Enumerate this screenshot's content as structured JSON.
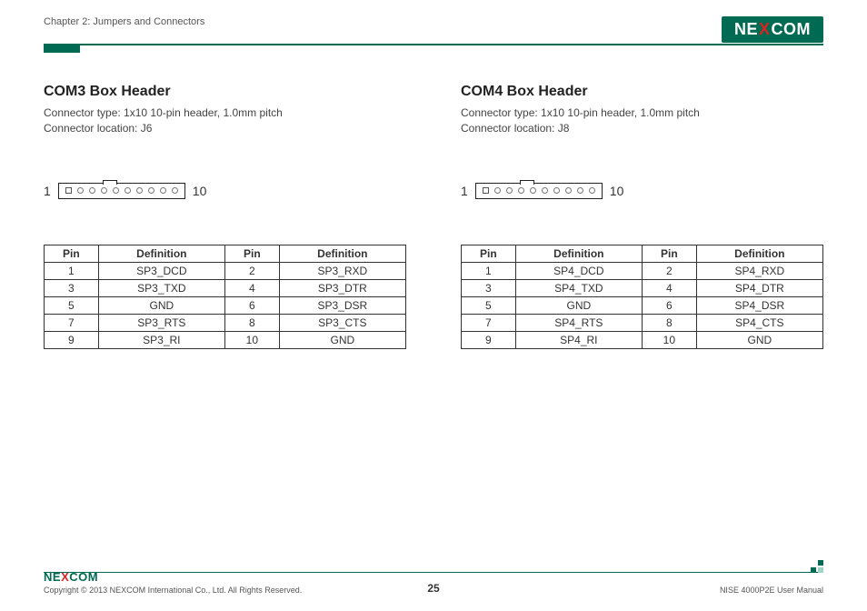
{
  "header": {
    "chapter": "Chapter 2: Jumpers and Connectors",
    "logo_pre": "NE",
    "logo_x": "X",
    "logo_post": "COM"
  },
  "left": {
    "title": "COM3 Box Header",
    "type_line": "Connector type: 1x10 10-pin header, 1.0mm pitch",
    "loc_line": "Connector location: J6",
    "pin_start": "1",
    "pin_end": "10",
    "headers": {
      "pin": "Pin",
      "def": "Definition"
    },
    "rows": [
      {
        "p1": "1",
        "d1": "SP3_DCD",
        "p2": "2",
        "d2": "SP3_RXD"
      },
      {
        "p1": "3",
        "d1": "SP3_TXD",
        "p2": "4",
        "d2": "SP3_DTR"
      },
      {
        "p1": "5",
        "d1": "GND",
        "p2": "6",
        "d2": "SP3_DSR"
      },
      {
        "p1": "7",
        "d1": "SP3_RTS",
        "p2": "8",
        "d2": "SP3_CTS"
      },
      {
        "p1": "9",
        "d1": "SP3_RI",
        "p2": "10",
        "d2": "GND"
      }
    ]
  },
  "right": {
    "title": "COM4 Box Header",
    "type_line": "Connector type: 1x10 10-pin header, 1.0mm pitch",
    "loc_line": "Connector location: J8",
    "pin_start": "1",
    "pin_end": "10",
    "headers": {
      "pin": "Pin",
      "def": "Definition"
    },
    "rows": [
      {
        "p1": "1",
        "d1": "SP4_DCD",
        "p2": "2",
        "d2": "SP4_RXD"
      },
      {
        "p1": "3",
        "d1": "SP4_TXD",
        "p2": "4",
        "d2": "SP4_DTR"
      },
      {
        "p1": "5",
        "d1": "GND",
        "p2": "6",
        "d2": "SP4_DSR"
      },
      {
        "p1": "7",
        "d1": "SP4_RTS",
        "p2": "8",
        "d2": "SP4_CTS"
      },
      {
        "p1": "9",
        "d1": "SP4_RI",
        "p2": "10",
        "d2": "GND"
      }
    ]
  },
  "footer": {
    "logo_pre": "NE",
    "logo_x": "X",
    "logo_post": "COM",
    "copyright": "Copyright © 2013 NEXCOM International Co., Ltd. All Rights Reserved.",
    "page": "25",
    "manual": "NISE 4000P2E User Manual"
  },
  "chart_data": [
    {
      "type": "table",
      "title": "COM3 Box Header Pin Definitions (J6)",
      "columns": [
        "Pin",
        "Definition"
      ],
      "rows": [
        [
          1,
          "SP3_DCD"
        ],
        [
          2,
          "SP3_RXD"
        ],
        [
          3,
          "SP3_TXD"
        ],
        [
          4,
          "SP3_DTR"
        ],
        [
          5,
          "GND"
        ],
        [
          6,
          "SP3_DSR"
        ],
        [
          7,
          "SP3_RTS"
        ],
        [
          8,
          "SP3_CTS"
        ],
        [
          9,
          "SP3_RI"
        ],
        [
          10,
          "GND"
        ]
      ]
    },
    {
      "type": "table",
      "title": "COM4 Box Header Pin Definitions (J8)",
      "columns": [
        "Pin",
        "Definition"
      ],
      "rows": [
        [
          1,
          "SP4_DCD"
        ],
        [
          2,
          "SP4_RXD"
        ],
        [
          3,
          "SP4_TXD"
        ],
        [
          4,
          "SP4_DTR"
        ],
        [
          5,
          "GND"
        ],
        [
          6,
          "SP4_DSR"
        ],
        [
          7,
          "SP4_RTS"
        ],
        [
          8,
          "SP4_CTS"
        ],
        [
          9,
          "SP4_RI"
        ],
        [
          10,
          "GND"
        ]
      ]
    }
  ]
}
